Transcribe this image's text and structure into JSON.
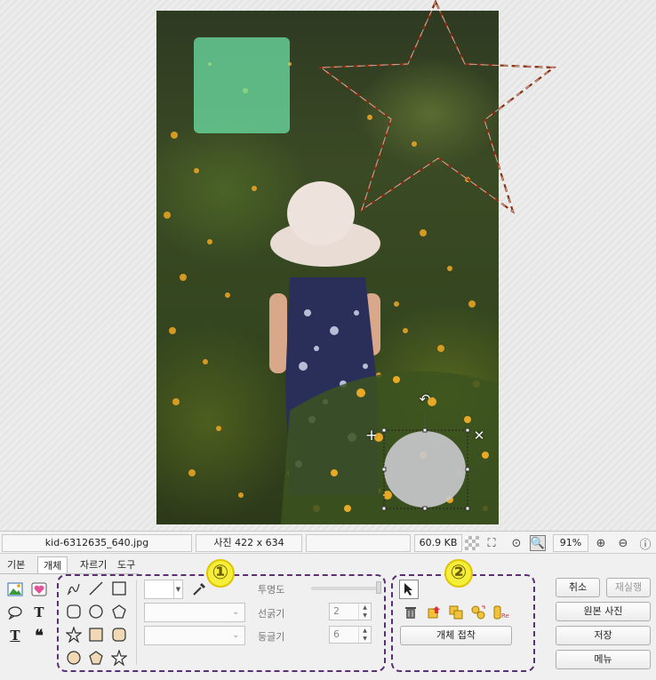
{
  "statusbar": {
    "filename": "kid-6312635_640.jpg",
    "photo_size": "사진 422 x 634",
    "file_size": "60.9 KB",
    "zoom": "91%"
  },
  "tabs": [
    {
      "label": "기본"
    },
    {
      "label": "개체"
    },
    {
      "label": "자르기"
    },
    {
      "label": "도구"
    }
  ],
  "badges": {
    "one": "①",
    "two": "②"
  },
  "object_props": {
    "opacity_label": "투명도",
    "line_width_label": "선굵기",
    "line_width_value": "2",
    "round_label": "둥글기",
    "round_value": "6"
  },
  "object_actions": {
    "paste_label": "개체 접착"
  },
  "side_buttons": {
    "cancel": "취소",
    "redo": "재실행",
    "original": "원본 사진",
    "save": "저장",
    "menu": "메뉴"
  },
  "colors": {
    "accent_dash": "#5b2f73",
    "star_dash": "#8a2f10",
    "badge_fill": "#f5ef3a",
    "overlay_rect": "#6ee6aa"
  }
}
